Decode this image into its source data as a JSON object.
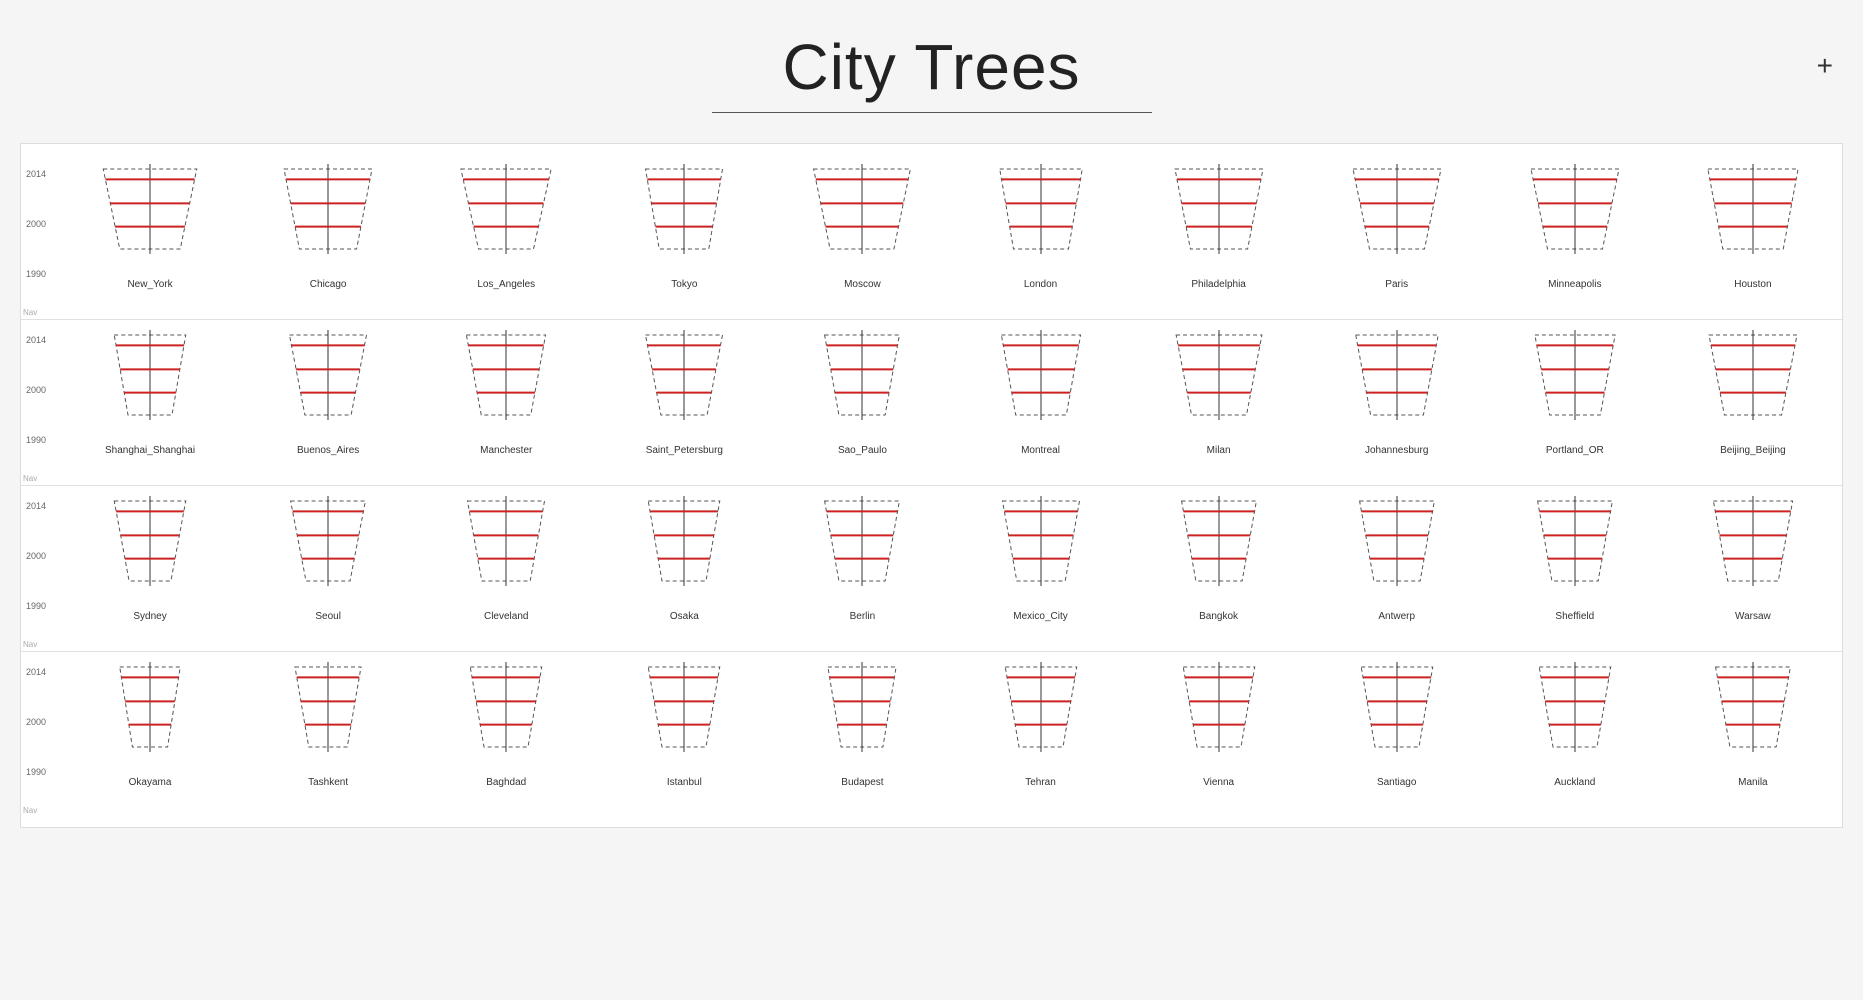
{
  "title": "City Trees",
  "plus_button": "+",
  "y_axis": {
    "top": "2014",
    "mid": "2000",
    "bottom": "1990"
  },
  "rows": [
    {
      "cities": [
        {
          "name": "New_York",
          "top_w": 0.85,
          "bot_w": 0.55,
          "line1": 0.15,
          "line2": 0.45,
          "line3": 0.72
        },
        {
          "name": "Chicago",
          "top_w": 0.8,
          "bot_w": 0.52,
          "line1": 0.15,
          "line2": 0.45,
          "line3": 0.72
        },
        {
          "name": "Los_Angeles",
          "top_w": 0.82,
          "bot_w": 0.5,
          "line1": 0.15,
          "line2": 0.45,
          "line3": 0.72
        },
        {
          "name": "Tokyo",
          "top_w": 0.7,
          "bot_w": 0.45,
          "line1": 0.15,
          "line2": 0.45,
          "line3": 0.72
        },
        {
          "name": "Moscow",
          "top_w": 0.88,
          "bot_w": 0.58,
          "line1": 0.15,
          "line2": 0.45,
          "line3": 0.72
        },
        {
          "name": "London",
          "top_w": 0.75,
          "bot_w": 0.5,
          "line1": 0.15,
          "line2": 0.45,
          "line3": 0.72
        },
        {
          "name": "Philadelphia",
          "top_w": 0.8,
          "bot_w": 0.52,
          "line1": 0.15,
          "line2": 0.45,
          "line3": 0.72
        },
        {
          "name": "Paris",
          "top_w": 0.8,
          "bot_w": 0.5,
          "line1": 0.15,
          "line2": 0.45,
          "line3": 0.72
        },
        {
          "name": "Minneapolis",
          "top_w": 0.8,
          "bot_w": 0.5,
          "line1": 0.15,
          "line2": 0.45,
          "line3": 0.72
        },
        {
          "name": "Houston",
          "top_w": 0.82,
          "bot_w": 0.55,
          "line1": 0.15,
          "line2": 0.45,
          "line3": 0.72
        }
      ]
    },
    {
      "cities": [
        {
          "name": "Shanghai_Shanghai",
          "top_w": 0.65,
          "bot_w": 0.4,
          "line1": 0.15,
          "line2": 0.45,
          "line3": 0.72
        },
        {
          "name": "Buenos_Aires",
          "top_w": 0.7,
          "bot_w": 0.42,
          "line1": 0.15,
          "line2": 0.45,
          "line3": 0.72
        },
        {
          "name": "Manchester",
          "top_w": 0.72,
          "bot_w": 0.45,
          "line1": 0.15,
          "line2": 0.45,
          "line3": 0.72
        },
        {
          "name": "Saint_Petersburg",
          "top_w": 0.7,
          "bot_w": 0.42,
          "line1": 0.15,
          "line2": 0.45,
          "line3": 0.72
        },
        {
          "name": "Sao_Paulo",
          "top_w": 0.68,
          "bot_w": 0.42,
          "line1": 0.15,
          "line2": 0.45,
          "line3": 0.72
        },
        {
          "name": "Montreal",
          "top_w": 0.72,
          "bot_w": 0.46,
          "line1": 0.15,
          "line2": 0.45,
          "line3": 0.72
        },
        {
          "name": "Milan",
          "top_w": 0.78,
          "bot_w": 0.5,
          "line1": 0.15,
          "line2": 0.45,
          "line3": 0.72
        },
        {
          "name": "Johannesburg",
          "top_w": 0.75,
          "bot_w": 0.48,
          "line1": 0.15,
          "line2": 0.45,
          "line3": 0.72
        },
        {
          "name": "Portland_OR",
          "top_w": 0.73,
          "bot_w": 0.46,
          "line1": 0.15,
          "line2": 0.45,
          "line3": 0.72
        },
        {
          "name": "Beijing_Beijing",
          "top_w": 0.8,
          "bot_w": 0.52,
          "line1": 0.15,
          "line2": 0.45,
          "line3": 0.72
        }
      ]
    },
    {
      "cities": [
        {
          "name": "Sydney",
          "top_w": 0.65,
          "bot_w": 0.38,
          "line1": 0.15,
          "line2": 0.45,
          "line3": 0.72
        },
        {
          "name": "Seoul",
          "top_w": 0.68,
          "bot_w": 0.4,
          "line1": 0.15,
          "line2": 0.45,
          "line3": 0.72
        },
        {
          "name": "Cleveland",
          "top_w": 0.7,
          "bot_w": 0.44,
          "line1": 0.15,
          "line2": 0.45,
          "line3": 0.72
        },
        {
          "name": "Osaka",
          "top_w": 0.65,
          "bot_w": 0.4,
          "line1": 0.15,
          "line2": 0.45,
          "line3": 0.72
        },
        {
          "name": "Berlin",
          "top_w": 0.68,
          "bot_w": 0.42,
          "line1": 0.15,
          "line2": 0.45,
          "line3": 0.72
        },
        {
          "name": "Mexico_City",
          "top_w": 0.7,
          "bot_w": 0.44,
          "line1": 0.15,
          "line2": 0.45,
          "line3": 0.72
        },
        {
          "name": "Bangkok",
          "top_w": 0.68,
          "bot_w": 0.42,
          "line1": 0.15,
          "line2": 0.45,
          "line3": 0.72
        },
        {
          "name": "Antwerp",
          "top_w": 0.68,
          "bot_w": 0.42,
          "line1": 0.15,
          "line2": 0.45,
          "line3": 0.72
        },
        {
          "name": "Sheffield",
          "top_w": 0.68,
          "bot_w": 0.42,
          "line1": 0.15,
          "line2": 0.45,
          "line3": 0.72
        },
        {
          "name": "Warsaw",
          "top_w": 0.72,
          "bot_w": 0.46,
          "line1": 0.15,
          "line2": 0.45,
          "line3": 0.72
        }
      ]
    },
    {
      "cities": [
        {
          "name": "Okayama",
          "top_w": 0.55,
          "bot_w": 0.32,
          "line1": 0.15,
          "line2": 0.45,
          "line3": 0.72
        },
        {
          "name": "Tashkent",
          "top_w": 0.6,
          "bot_w": 0.35,
          "line1": 0.15,
          "line2": 0.45,
          "line3": 0.72
        },
        {
          "name": "Baghdad",
          "top_w": 0.65,
          "bot_w": 0.4,
          "line1": 0.15,
          "line2": 0.45,
          "line3": 0.72
        },
        {
          "name": "Istanbul",
          "top_w": 0.65,
          "bot_w": 0.4,
          "line1": 0.15,
          "line2": 0.45,
          "line3": 0.72
        },
        {
          "name": "Budapest",
          "top_w": 0.62,
          "bot_w": 0.38,
          "line1": 0.15,
          "line2": 0.45,
          "line3": 0.72
        },
        {
          "name": "Tehran",
          "top_w": 0.65,
          "bot_w": 0.4,
          "line1": 0.15,
          "line2": 0.45,
          "line3": 0.72
        },
        {
          "name": "Vienna",
          "top_w": 0.65,
          "bot_w": 0.4,
          "line1": 0.15,
          "line2": 0.45,
          "line3": 0.72
        },
        {
          "name": "Santiago",
          "top_w": 0.65,
          "bot_w": 0.4,
          "line1": 0.15,
          "line2": 0.45,
          "line3": 0.72
        },
        {
          "name": "Auckland",
          "top_w": 0.65,
          "bot_w": 0.4,
          "line1": 0.15,
          "line2": 0.45,
          "line3": 0.72
        },
        {
          "name": "Manila",
          "top_w": 0.68,
          "bot_w": 0.42,
          "line1": 0.15,
          "line2": 0.45,
          "line3": 0.72
        }
      ]
    }
  ]
}
